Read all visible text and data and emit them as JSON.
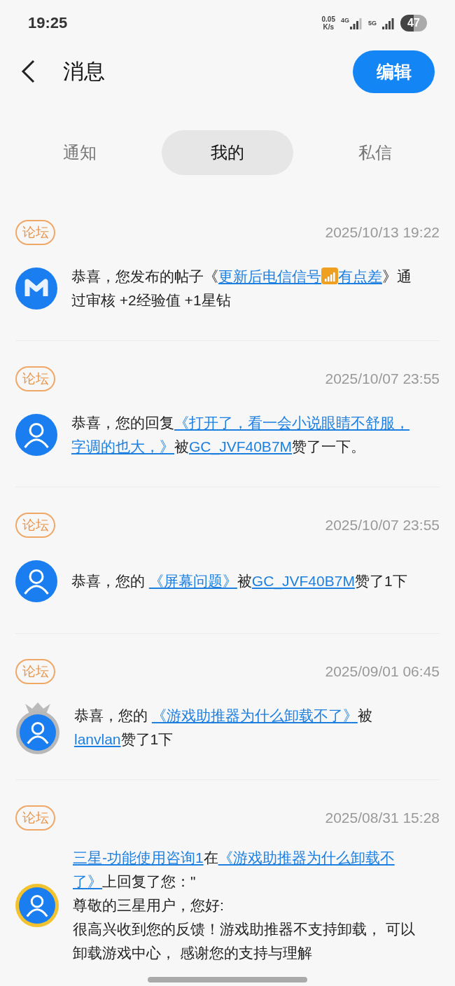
{
  "status_bar": {
    "time": "19:25",
    "speed": "0.05",
    "speed_unit": "K/s",
    "net_1": "4G",
    "net_2": "5G",
    "battery": "47"
  },
  "header": {
    "title": "消息",
    "edit_button": "编辑"
  },
  "tabs": [
    {
      "label": "通知",
      "selected": false
    },
    {
      "label": "我的",
      "selected": true
    },
    {
      "label": "私信",
      "selected": false
    }
  ],
  "messages": [
    {
      "tag": "论坛",
      "time": "2025/10/13 19:22",
      "avatar": {
        "kind": "logo"
      },
      "lines": [
        [
          {
            "kind": "text",
            "text": "恭喜，您发布的帖子《"
          },
          {
            "kind": "link",
            "text": "更新后电信信号",
            "after_icon": "有点差"
          },
          {
            "kind": "text",
            "text": "》通"
          }
        ],
        [
          {
            "kind": "text",
            "text": "过审核 +2经验值 +1星钻"
          }
        ]
      ]
    },
    {
      "tag": "论坛",
      "time": "2025/10/07 23:55",
      "avatar": {
        "kind": "user"
      },
      "lines": [
        [
          {
            "kind": "text",
            "text": "恭喜，您的回复"
          },
          {
            "kind": "link",
            "text": "《打开了，看一会小说眼睛不舒服，"
          }
        ],
        [
          {
            "kind": "link",
            "text": "字调的也大，》"
          },
          {
            "kind": "text",
            "text": "被"
          },
          {
            "kind": "link",
            "text": "GC_JVF40B7M"
          },
          {
            "kind": "text",
            "text": "赞了一下。"
          }
        ]
      ]
    },
    {
      "tag": "论坛",
      "time": "2025/10/07 23:55",
      "avatar": {
        "kind": "user"
      },
      "lines": [
        [
          {
            "kind": "text",
            "text": "恭喜，您的 "
          },
          {
            "kind": "link",
            "text": "《屏幕问题》"
          },
          {
            "kind": "text",
            "text": "被"
          },
          {
            "kind": "link",
            "text": "GC_JVF40B7M"
          },
          {
            "kind": "text",
            "text": "赞了1下"
          }
        ]
      ]
    },
    {
      "tag": "论坛",
      "time": "2025/09/01 06:45",
      "avatar": {
        "kind": "crowned"
      },
      "lines": [
        [
          {
            "kind": "text",
            "text": "恭喜，您的 "
          },
          {
            "kind": "link",
            "text": "《游戏助推器为什么卸载不了》"
          },
          {
            "kind": "text",
            "text": "被"
          }
        ],
        [
          {
            "kind": "link",
            "text": "lanvlan"
          },
          {
            "kind": "text",
            "text": "赞了1下"
          }
        ]
      ]
    },
    {
      "tag": "论坛",
      "time": "2025/08/31 15:28",
      "avatar": {
        "kind": "ringed"
      },
      "lines": [
        [
          {
            "kind": "link",
            "text": "三星-功能使用咨询1"
          },
          {
            "kind": "text",
            "text": "在"
          },
          {
            "kind": "link",
            "text": "《游戏助推器为什么卸载不"
          }
        ],
        [
          {
            "kind": "link",
            "text": "了》"
          },
          {
            "kind": "text",
            "text": "上回复了您：\""
          }
        ],
        [
          {
            "kind": "text",
            "text": "尊敬的三星用户，您好:"
          }
        ],
        [
          {
            "kind": "text",
            "text": "很高兴收到您的反馈！游戏助推器不支持卸载， 可以"
          }
        ],
        [
          {
            "kind": "text",
            "text": "卸载游戏中心， 感谢您的支持与理解"
          }
        ]
      ]
    }
  ]
}
